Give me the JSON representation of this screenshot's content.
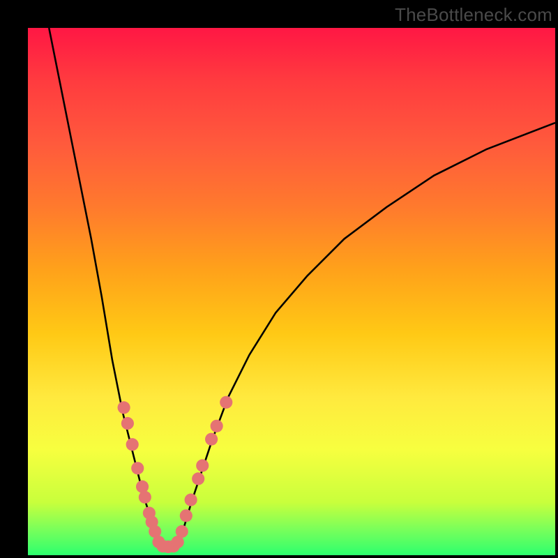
{
  "watermark": "TheBottleneck.com",
  "chart_data": {
    "type": "line",
    "title": "",
    "xlabel": "",
    "ylabel": "",
    "xlim": [
      0,
      100
    ],
    "ylim": [
      0,
      100
    ],
    "grid": false,
    "legend": false,
    "series": [
      {
        "name": "left-branch",
        "stroke": "#000000",
        "x": [
          4,
          6,
          8,
          10,
          12,
          14,
          15,
          16,
          17,
          18,
          19,
          20,
          21,
          22,
          23,
          24,
          24.8
        ],
        "y": [
          100,
          90,
          80,
          70,
          60,
          49,
          43,
          37,
          32,
          27,
          23,
          19,
          15,
          11,
          8,
          5,
          2
        ]
      },
      {
        "name": "flat-valley",
        "stroke": "#000000",
        "x": [
          24.8,
          25.5,
          26.5,
          27.5,
          28.3
        ],
        "y": [
          2,
          1.6,
          1.5,
          1.6,
          2
        ]
      },
      {
        "name": "right-branch",
        "stroke": "#000000",
        "x": [
          28.3,
          29.5,
          31,
          33,
          35,
          38,
          42,
          47,
          53,
          60,
          68,
          77,
          87,
          100
        ],
        "y": [
          2,
          5,
          10,
          16,
          22,
          30,
          38,
          46,
          53,
          60,
          66,
          72,
          77,
          82
        ]
      }
    ],
    "markers": {
      "color": "#e57373",
      "radius_pct": 1.2,
      "points": [
        {
          "x": 18.2,
          "y": 28
        },
        {
          "x": 18.9,
          "y": 25
        },
        {
          "x": 19.8,
          "y": 21
        },
        {
          "x": 20.8,
          "y": 16.5
        },
        {
          "x": 21.7,
          "y": 13
        },
        {
          "x": 22.2,
          "y": 11
        },
        {
          "x": 23.0,
          "y": 8
        },
        {
          "x": 23.5,
          "y": 6.3
        },
        {
          "x": 24.1,
          "y": 4.5
        },
        {
          "x": 24.8,
          "y": 2.5
        },
        {
          "x": 25.6,
          "y": 1.7
        },
        {
          "x": 26.6,
          "y": 1.6
        },
        {
          "x": 27.6,
          "y": 1.7
        },
        {
          "x": 28.4,
          "y": 2.5
        },
        {
          "x": 29.2,
          "y": 4.5
        },
        {
          "x": 30.0,
          "y": 7.5
        },
        {
          "x": 30.9,
          "y": 10.5
        },
        {
          "x": 32.3,
          "y": 14.5
        },
        {
          "x": 33.1,
          "y": 17
        },
        {
          "x": 34.8,
          "y": 22
        },
        {
          "x": 35.8,
          "y": 24.5
        },
        {
          "x": 37.6,
          "y": 29
        }
      ]
    }
  }
}
